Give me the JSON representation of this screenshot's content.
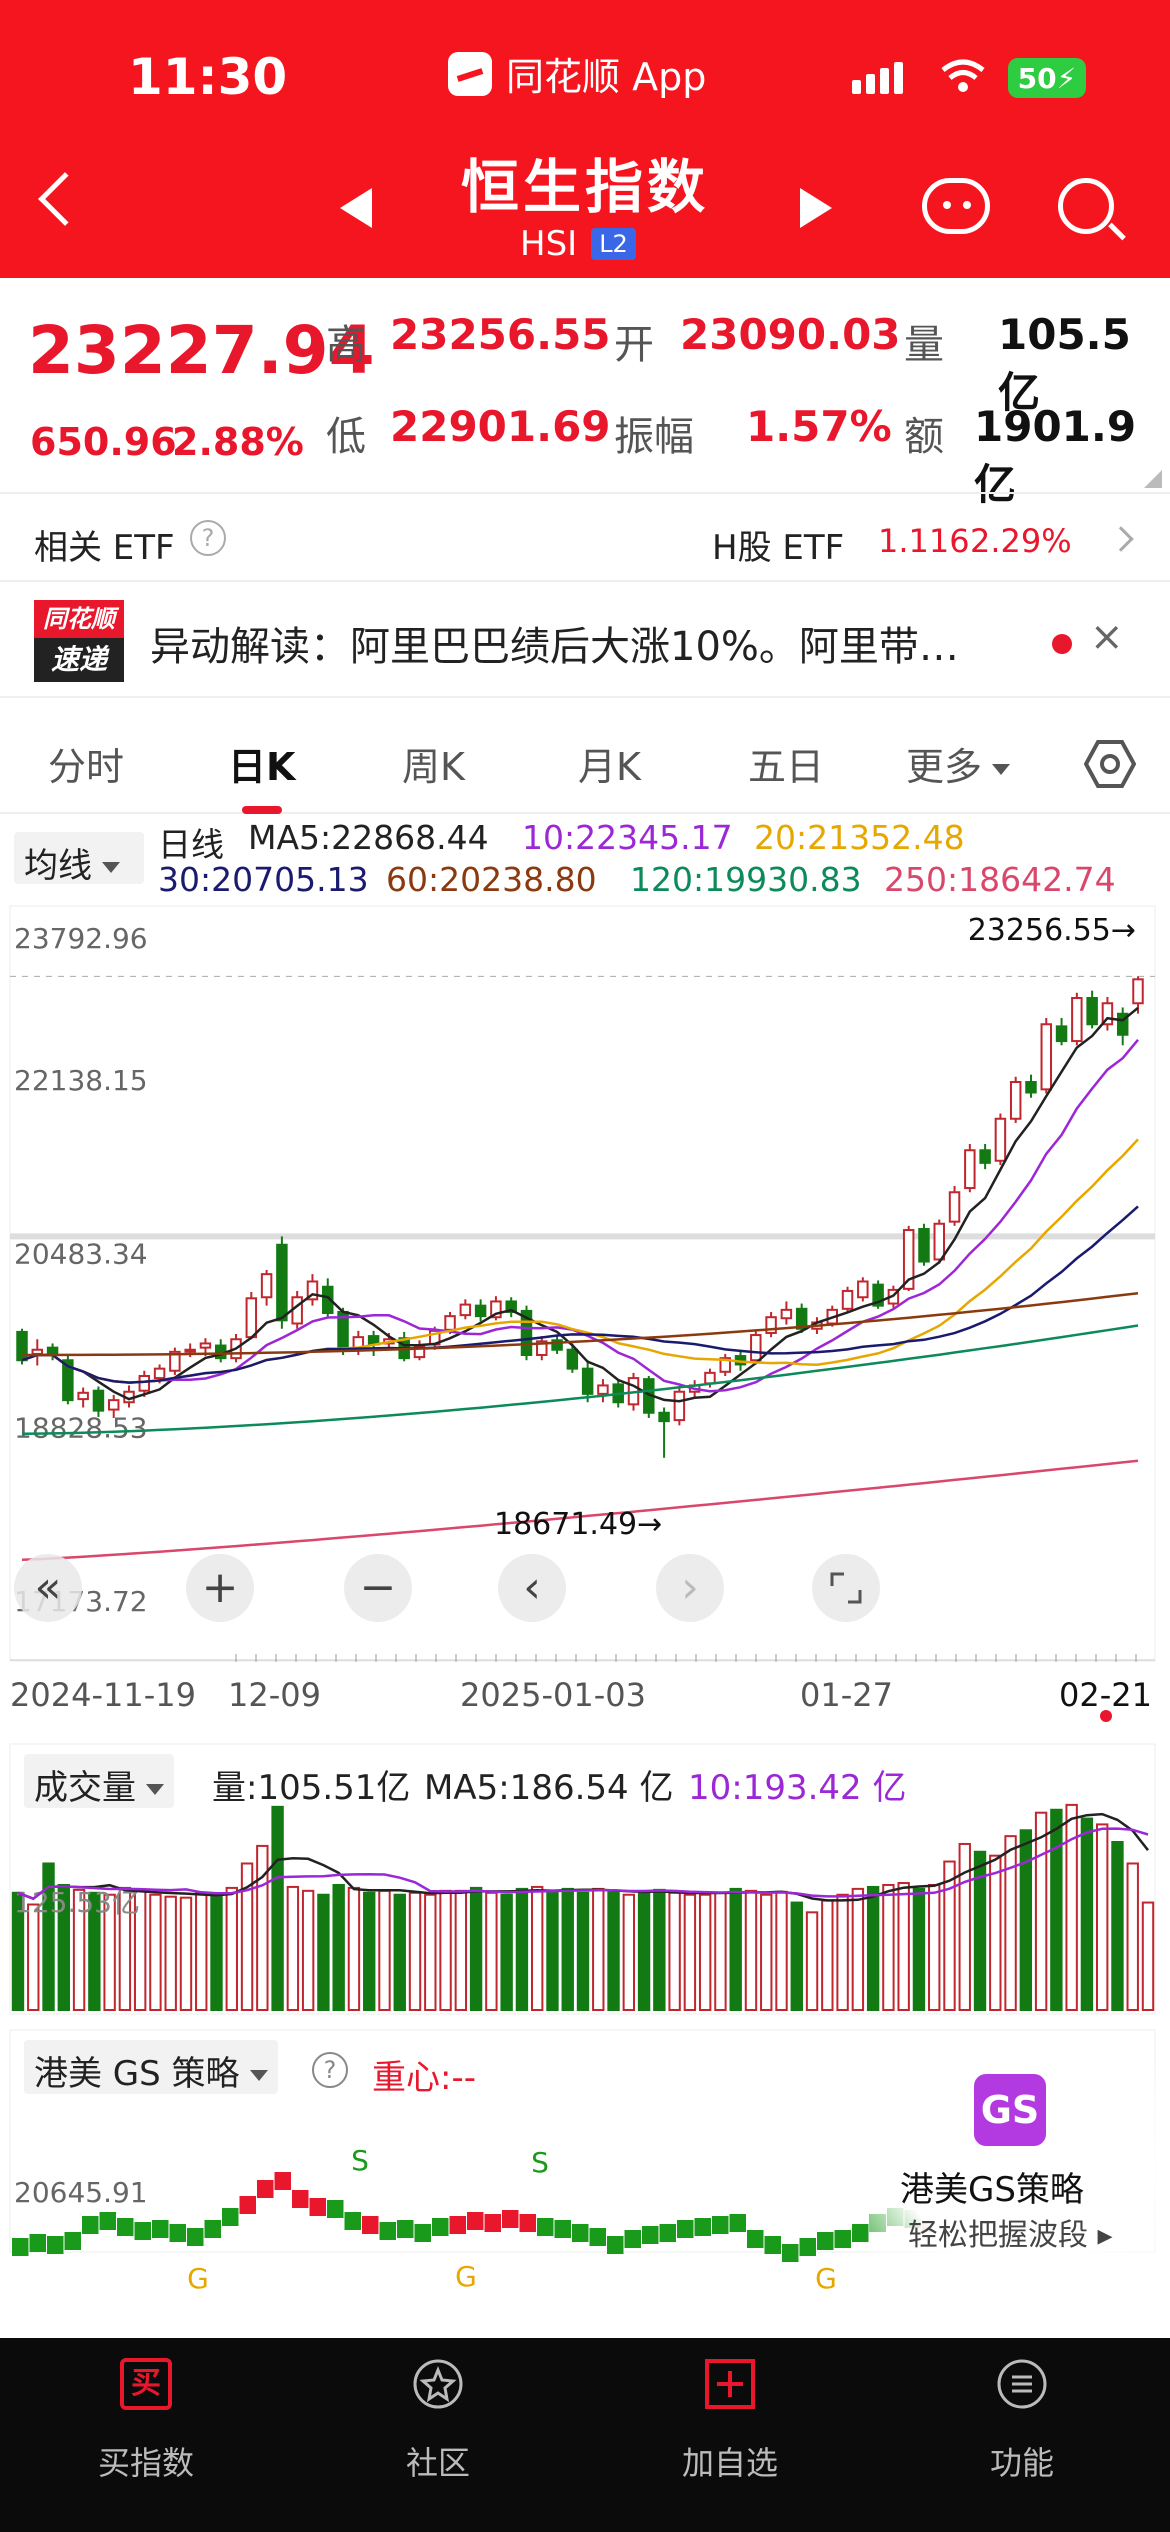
{
  "status_bar": {
    "time": "11:30",
    "app_name": "同花顺 App",
    "battery": "50"
  },
  "header": {
    "title": "恒生指数",
    "code": "HSI",
    "level": "L2"
  },
  "quote": {
    "price": "23227.94",
    "change": "650.96",
    "change_pct": "2.88%",
    "high_label": "高",
    "high": "23256.55",
    "open_label": "开",
    "open": "23090.03",
    "volume_label": "量",
    "volume": "105.5亿",
    "low_label": "低",
    "low": "22901.69",
    "amplitude_label": "振幅",
    "amplitude": "1.57%",
    "amount_label": "额",
    "amount": "1901.9亿"
  },
  "etf": {
    "label": "相关 ETF",
    "help": "?",
    "h_name": "H股 ETF",
    "h_price": "1.116",
    "h_pct": "2.29%"
  },
  "news": {
    "logo_top": "同花顺",
    "logo_bottom": "速递",
    "text": "异动解读：阿里巴巴绩后大涨10%。阿里带…",
    "close": "×"
  },
  "tabs": [
    {
      "label": "分时"
    },
    {
      "label": "日K"
    },
    {
      "label": "周K"
    },
    {
      "label": "月K"
    },
    {
      "label": "五日"
    },
    {
      "label": "更多"
    }
  ],
  "ma_legend": {
    "select": "均线",
    "period": "日线",
    "items": [
      {
        "text": "MA5:22868.44",
        "color": "#222222"
      },
      {
        "text": "10:22345.17",
        "color": "#9b27d6"
      },
      {
        "text": "20:21352.48",
        "color": "#e6a700"
      },
      {
        "text": "30:20705.13",
        "color": "#1a1a6e"
      },
      {
        "text": "60:20238.80",
        "color": "#8b3a10"
      },
      {
        "text": "120:19930.83",
        "color": "#0c8a5a"
      },
      {
        "text": "250:18642.74",
        "color": "#d9476a"
      }
    ]
  },
  "chart_data": [
    {
      "type": "candlestick",
      "title": "",
      "y_ticks": [
        "23792.96",
        "22138.15",
        "20483.34",
        "18828.53",
        "17173.72"
      ],
      "ylim": [
        17173.72,
        23792.96
      ],
      "x_ticks": [
        "2024-11-19",
        "12-09",
        "2025-01-03",
        "01-27",
        "02-21"
      ],
      "annotations": {
        "max_label": "23256.55→",
        "min_label": "18671.49→"
      },
      "candles": [
        [
          19870,
          19600,
          19900,
          19560
        ],
        [
          19660,
          19700,
          19800,
          19550
        ],
        [
          19720,
          19650,
          19760,
          19600
        ],
        [
          19600,
          19220,
          19650,
          19180
        ],
        [
          19230,
          19290,
          19340,
          19150
        ],
        [
          19310,
          19120,
          19350,
          19060
        ],
        [
          19130,
          19220,
          19270,
          19050
        ],
        [
          19200,
          19300,
          19360,
          19150
        ],
        [
          19310,
          19450,
          19500,
          19250
        ],
        [
          19430,
          19520,
          19560,
          19380
        ],
        [
          19500,
          19680,
          19720,
          19460
        ],
        [
          19700,
          19700,
          19760,
          19630
        ],
        [
          19720,
          19760,
          19810,
          19640
        ],
        [
          19740,
          19620,
          19800,
          19580
        ],
        [
          19620,
          19800,
          19850,
          19580
        ],
        [
          19820,
          20190,
          20250,
          19800
        ],
        [
          20200,
          20420,
          20460,
          20120
        ],
        [
          20700,
          19980,
          20780,
          19900
        ],
        [
          19950,
          20200,
          20260,
          19900
        ],
        [
          20180,
          20350,
          20420,
          20120
        ],
        [
          20300,
          20050,
          20380,
          20000
        ],
        [
          20060,
          19720,
          20100,
          19650
        ],
        [
          19720,
          19820,
          19880,
          19650
        ],
        [
          19830,
          19750,
          19880,
          19640
        ],
        [
          19760,
          19800,
          19860,
          19700
        ],
        [
          19810,
          19620,
          19870,
          19590
        ],
        [
          19630,
          19730,
          19790,
          19600
        ],
        [
          19750,
          19880,
          19920,
          19700
        ],
        [
          19890,
          20020,
          20060,
          19850
        ],
        [
          20030,
          20130,
          20180,
          19990
        ],
        [
          20120,
          20020,
          20180,
          19970
        ],
        [
          20010,
          20160,
          20210,
          19980
        ],
        [
          20160,
          20060,
          20200,
          20010
        ],
        [
          20070,
          19650,
          20120,
          19600
        ],
        [
          19650,
          19780,
          19830,
          19600
        ],
        [
          19790,
          19700,
          19840,
          19660
        ],
        [
          19700,
          19520,
          19760,
          19480
        ],
        [
          19520,
          19280,
          19600,
          19200
        ],
        [
          19280,
          19360,
          19420,
          19200
        ],
        [
          19370,
          19200,
          19410,
          19150
        ],
        [
          19180,
          19430,
          19480,
          19120
        ],
        [
          19420,
          19100,
          19450,
          19050
        ],
        [
          19100,
          19020,
          19150,
          18671
        ],
        [
          19030,
          19300,
          19350,
          18980
        ],
        [
          19300,
          19360,
          19410,
          19250
        ],
        [
          19380,
          19480,
          19520,
          19340
        ],
        [
          19490,
          19620,
          19660,
          19450
        ],
        [
          19640,
          19560,
          19700,
          19500
        ],
        [
          19600,
          19840,
          19880,
          19560
        ],
        [
          19860,
          20010,
          20060,
          19820
        ],
        [
          20000,
          20080,
          20160,
          19940
        ],
        [
          20090,
          19900,
          20140,
          19860
        ],
        [
          19900,
          19960,
          20010,
          19850
        ],
        [
          19950,
          20080,
          20120,
          19920
        ],
        [
          20090,
          20260,
          20300,
          20050
        ],
        [
          20200,
          20350,
          20390,
          20160
        ],
        [
          20320,
          20120,
          20360,
          20090
        ],
        [
          20140,
          20270,
          20310,
          20100
        ],
        [
          20280,
          20840,
          20880,
          20260
        ],
        [
          20850,
          20540,
          20900,
          20500
        ],
        [
          20560,
          20900,
          20940,
          20520
        ],
        [
          20920,
          21200,
          21260,
          20880
        ],
        [
          21240,
          21600,
          21660,
          21200
        ],
        [
          21600,
          21480,
          21660,
          21420
        ],
        [
          21500,
          21900,
          21950,
          21460
        ],
        [
          21900,
          22250,
          22300,
          21860
        ],
        [
          22250,
          22150,
          22320,
          22100
        ],
        [
          22180,
          22800,
          22860,
          22140
        ],
        [
          22780,
          22640,
          22860,
          22600
        ],
        [
          22640,
          23050,
          23100,
          22600
        ],
        [
          23050,
          22800,
          23120,
          22760
        ],
        [
          22800,
          23000,
          23060,
          22740
        ],
        [
          22900,
          22700,
          22960,
          22600
        ],
        [
          23000,
          23228,
          23256,
          22901
        ]
      ],
      "ma_series_end": {
        "MA5": 22868.44,
        "MA10": 22345.17,
        "MA20": 21352.48,
        "MA30": 20705.13,
        "MA60": 20238.8,
        "MA120": 19930.83,
        "MA250": 18642.74
      }
    },
    {
      "type": "bar",
      "title": "成交量",
      "y_label_text": "125.53亿",
      "values": [
        120,
        108,
        150,
        128,
        123,
        120,
        118,
        125,
        122,
        118,
        116,
        115,
        120,
        118,
        125,
        150,
        168,
        208,
        126,
        122,
        118,
        128,
        125,
        120,
        122,
        118,
        120,
        118,
        122,
        122,
        125,
        120,
        118,
        124,
        126,
        122,
        124,
        120,
        124,
        122,
        118,
        120,
        123,
        120,
        118,
        118,
        120,
        124,
        122,
        118,
        121,
        110,
        100,
        112,
        118,
        124,
        126,
        128,
        130,
        124,
        128,
        152,
        170,
        162,
        158,
        178,
        184,
        202,
        205,
        210,
        196,
        190,
        172,
        150,
        110
      ]
    }
  ],
  "chart_controls": {
    "collapse": "«",
    "zoom_in": "+",
    "zoom_out": "−",
    "left": "‹",
    "right": "›"
  },
  "volume_panel": {
    "select": "成交量",
    "vol": "量:105.51亿",
    "ma5": "MA5:186.54 亿",
    "ma10": "10:193.42 亿",
    "ytick": "125.53亿"
  },
  "gs_panel": {
    "select": "港美 GS 策略",
    "help": "?",
    "center": "重心:--",
    "ytick": "20645.91",
    "marker_g": "G",
    "marker_s": "S"
  },
  "gs_promo": {
    "logo": "GS",
    "title": "港美GS策略",
    "sub": "轻松把握波段 ▸"
  },
  "bottom_nav": [
    {
      "label": "买指数",
      "icon_text": "买"
    },
    {
      "label": "社区"
    },
    {
      "label": "加自选"
    },
    {
      "label": "功能"
    }
  ],
  "colors": {
    "up": "#e8172c",
    "down": "#137a13",
    "header": "#f5151f"
  }
}
